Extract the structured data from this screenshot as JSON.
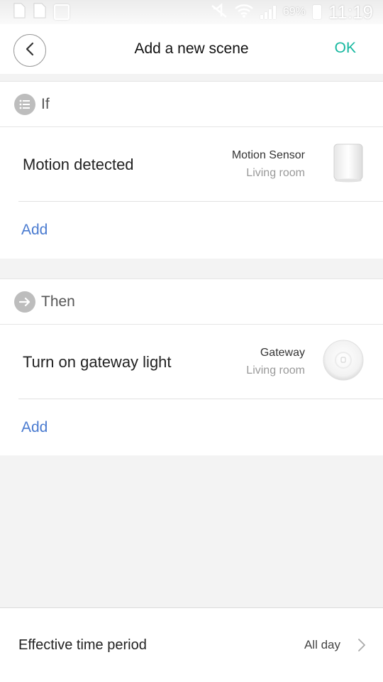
{
  "status_bar": {
    "battery": "69%",
    "time": "11:19",
    "icons": [
      "sim-icon",
      "sd-card-icon",
      "image-icon",
      "mute-icon",
      "wifi-icon",
      "signal-icon",
      "battery-icon"
    ]
  },
  "header": {
    "title": "Add a new scene",
    "ok_label": "OK",
    "back_icon": "chevron-left-icon"
  },
  "if_section": {
    "label": "If",
    "icon": "list-icon",
    "condition": {
      "action": "Motion detected",
      "device_name": "Motion Sensor",
      "room": "Living room",
      "device_icon": "motion-sensor-icon"
    },
    "add_label": "Add"
  },
  "then_section": {
    "label": "Then",
    "icon": "arrow-right-icon",
    "action": {
      "action": "Turn on gateway light",
      "device_name": "Gateway",
      "room": "Living room",
      "device_icon": "gateway-icon"
    },
    "add_label": "Add"
  },
  "footer": {
    "label": "Effective time period",
    "value": "All day",
    "icon": "chevron-right-icon"
  },
  "colors": {
    "accent_ok": "#17b8a0",
    "link_blue": "#4a7bd0",
    "background": "#f3f3f3"
  }
}
